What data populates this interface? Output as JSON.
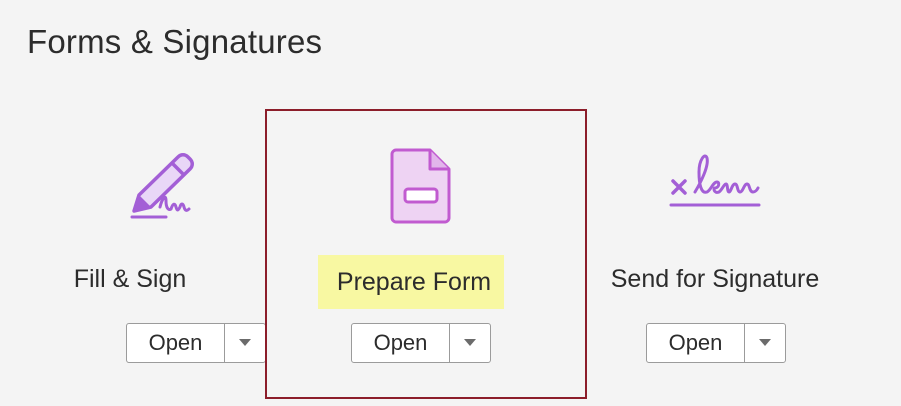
{
  "section": {
    "title": "Forms & Signatures"
  },
  "tools": [
    {
      "label": "Fill & Sign",
      "icon": "fill-sign-pen-icon",
      "open_label": "Open",
      "dropdown_icon": "chevron-down-icon"
    },
    {
      "label": "Prepare Form",
      "icon": "prepare-form-document-icon",
      "open_label": "Open",
      "dropdown_icon": "chevron-down-icon",
      "selected": true,
      "highlighted": true
    },
    {
      "label": "Send for Signature",
      "icon": "send-for-signature-icon",
      "open_label": "Open",
      "dropdown_icon": "chevron-down-icon"
    }
  ],
  "colors": {
    "icon_accent": "#a35fd6",
    "icon_fill_light": "#eed3f3",
    "icon_stroke_magenta": "#c15bd0",
    "selection_border": "#8c1d2a",
    "label_highlight": "#f8f8a2",
    "background": "#f4f4f4"
  }
}
